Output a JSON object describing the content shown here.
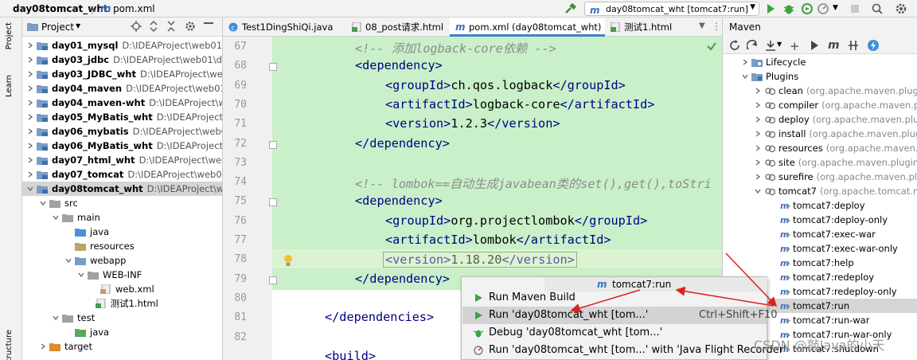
{
  "navbar": {
    "project": "day08tomcat_wht",
    "file": "pom.xml",
    "run_config": "day08tomcat_wht [tomcat7:run]"
  },
  "leftstrip": {
    "project_tab": "Project",
    "learn_tab": "Learn",
    "structure_tab": "Structure"
  },
  "project_panel": {
    "title": "Project",
    "rows": [
      {
        "name": "day01_mysql",
        "path": "D:\\IDEAProject\\web01\\day0"
      },
      {
        "name": "day03_jdbc",
        "path": "D:\\IDEAProject\\web01\\day03"
      },
      {
        "name": "day03_JDBC_wht",
        "path": "D:\\IDEAProject\\web01\\d"
      },
      {
        "name": "day04_maven",
        "path": "D:\\IDEAProject\\web01\\day"
      },
      {
        "name": "day04_maven-wht",
        "path": "D:\\IDEAProject\\web0"
      },
      {
        "name": "day05_MyBatis_wht",
        "path": "D:\\IDEAProject\\web"
      },
      {
        "name": "day06_mybatis",
        "path": "D:\\IDEAProject\\web01\\da"
      },
      {
        "name": "day06_MyBatis_wht",
        "path": "D:\\IDEAProject\\web"
      },
      {
        "name": "day07_html_wht",
        "path": "D:\\IDEAProject\\web01\\c"
      },
      {
        "name": "day07_tomcat",
        "path": "D:\\IDEAProject\\web01\\day"
      },
      {
        "name": "day08tomcat_wht",
        "path": "D:\\IDEAProject\\web01"
      }
    ],
    "tree": {
      "src": "src",
      "main": "main",
      "java": "java",
      "resources": "resources",
      "webapp": "webapp",
      "webinf": "WEB-INF",
      "webxml": "web.xml",
      "html": "测试1.html",
      "test": "test",
      "test_java": "java",
      "target": "target"
    }
  },
  "tabs": [
    {
      "label": "Test1DingShiQi.java"
    },
    {
      "label": "08_post请求.html"
    },
    {
      "label": "pom.xml (day08tomcat_wht)"
    },
    {
      "label": "测试1.html"
    }
  ],
  "editor": {
    "line_numbers": [
      "67",
      "68",
      "69",
      "70",
      "71",
      "72",
      "73",
      "74",
      "75",
      "76",
      "77",
      "78",
      "79",
      "80",
      "81",
      "82"
    ],
    "lines": {
      "l67": "<!-- 添加logback-core依赖 -->",
      "l68": "dependency",
      "l69a": "groupId",
      "l69b": "ch.qos.logback",
      "l70a": "artifactId",
      "l70b": "logback-core",
      "l71a": "version",
      "l71b": "1.2.3",
      "l72": "dependency",
      "l74": "<!-- lombok==自动生成javabean类的set(),get(),toStri",
      "l75": "dependency",
      "l76a": "groupId",
      "l76b": "org.projectlombok",
      "l77a": "artifactId",
      "l77b": "lombok",
      "l78a": "version",
      "l78b": "1.18.20",
      "l79": "dependency",
      "l81": "dependencies",
      "l83": "build"
    }
  },
  "maven": {
    "title": "Maven",
    "items": [
      {
        "name": "Lifecycle",
        "extra": ""
      },
      {
        "name": "Plugins",
        "extra": ""
      },
      {
        "name": "clean",
        "extra": "(org.apache.maven.plugin"
      },
      {
        "name": "compiler",
        "extra": "(org.apache.maven.pl"
      },
      {
        "name": "deploy",
        "extra": "(org.apache.maven.plu"
      },
      {
        "name": "install",
        "extra": "(org.apache.maven.plugi"
      },
      {
        "name": "resources",
        "extra": "(org.apache.maven.pl"
      },
      {
        "name": "site",
        "extra": "(org.apache.maven.plugins"
      },
      {
        "name": "surefire",
        "extra": "(org.apache.maven.plug"
      },
      {
        "name": "tomcat7",
        "extra": "(org.apache.tomcat.m"
      }
    ],
    "goals": [
      "tomcat7:deploy",
      "tomcat7:deploy-only",
      "tomcat7:exec-war",
      "tomcat7:exec-war-only",
      "tomcat7:help",
      "tomcat7:redeploy",
      "tomcat7:redeploy-only",
      "tomcat7:run",
      "tomcat7:run-war",
      "tomcat7:run-war-only",
      "tomcat7:shutdown"
    ]
  },
  "popup": {
    "title": "tomcat7:run",
    "items": [
      {
        "label": "Run Maven Build",
        "shortcut": ""
      },
      {
        "label": "Run 'day08tomcat_wht [tom...'",
        "shortcut": "Ctrl+Shift+F10"
      },
      {
        "label": "Debug 'day08tomcat_wht [tom...'",
        "shortcut": ""
      },
      {
        "label": "Run 'day08tomcat_wht [tom...' with 'Java Flight Recorder'",
        "shortcut": ""
      }
    ]
  },
  "watermark": "CSDN @敲Java的小天",
  "colors": {
    "accent": "#4083c9",
    "code_highlight": "#c9f0c9",
    "annotation_arrow": "#e02020"
  }
}
